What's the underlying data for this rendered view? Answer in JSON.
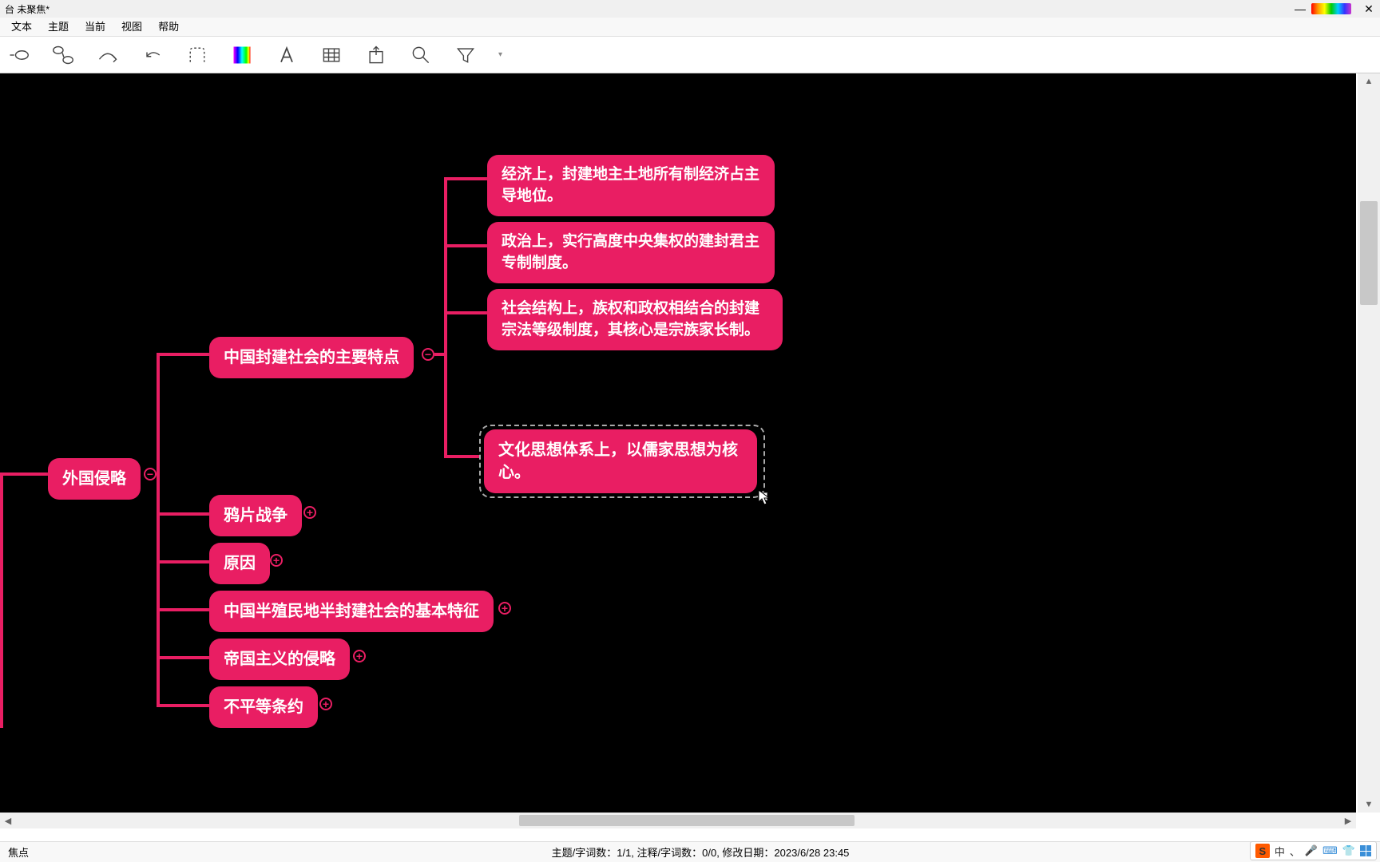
{
  "window_title": "台 未聚焦*",
  "menubar": [
    "文本",
    "主题",
    "当前",
    "视图",
    "帮助"
  ],
  "statusbar": {
    "left": "焦点",
    "center": "主题/字词数：1/1, 注释/字词数：0/0, 修改日期：2023/6/28 23:45"
  },
  "ime": {
    "logo": "S",
    "lang": "中",
    "dot": "、"
  },
  "mindmap": {
    "root": "外国侵略",
    "b1": {
      "label": "中国封建社会的主要特点",
      "children": [
        "经济上，封建地主土地所有制经济占主导地位。",
        "政治上，实行高度中央集权的建封君主专制制度。",
        "社会结构上，族权和政权相结合的封建宗法等级制度，其核心是宗族家长制。",
        "文化思想体系上，以儒家思想为核心。"
      ]
    },
    "siblings": [
      "鸦片战争",
      "原因",
      "中国半殖民地半封建社会的基本特征",
      "帝国主义的侵略",
      "不平等条约"
    ]
  },
  "toggles": {
    "minus": "−",
    "plus": "+"
  }
}
